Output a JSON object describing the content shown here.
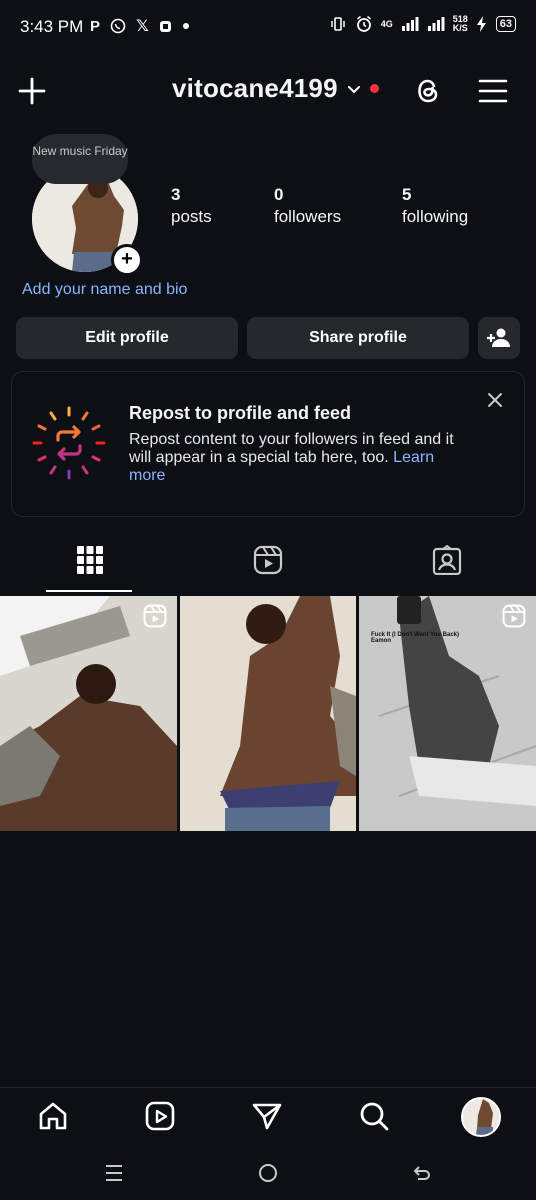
{
  "status_bar": {
    "time": "3:43 PM",
    "left_icons": [
      "p-icon",
      "whatsapp-icon",
      "x-icon",
      "app-icon",
      "dot-icon"
    ],
    "network": "4G",
    "speed_value": "518",
    "speed_unit": "K/S",
    "battery": "63"
  },
  "header": {
    "username": "vitocane4199"
  },
  "profile": {
    "note": "New music Friday",
    "stats": [
      {
        "value": "3",
        "label": "posts"
      },
      {
        "value": "0",
        "label": "followers"
      },
      {
        "value": "5",
        "label": "following"
      }
    ],
    "bio_link": "Add your name and bio",
    "edit_button": "Edit profile",
    "share_button": "Share profile"
  },
  "repost_card": {
    "title": "Repost to profile and feed",
    "body": "Repost content to your followers in feed and it will appear in a special tab here, too.",
    "learn_more": "Learn more"
  },
  "tabs": [
    "grid-icon",
    "reels-icon",
    "tagged-icon"
  ],
  "posts": [
    {
      "type": "reel",
      "caption_line1": "",
      "caption_line2": ""
    },
    {
      "type": "photo",
      "caption_line1": "",
      "caption_line2": ""
    },
    {
      "type": "reel",
      "caption_line1": "Fuck It (I Don't Want You Back)",
      "caption_line2": "Eamon"
    }
  ],
  "bottom_nav": [
    "home-icon",
    "reels-icon",
    "messages-icon",
    "search-icon",
    "profile-avatar"
  ],
  "system_nav": [
    "recents-icon",
    "home-circle-icon",
    "back-icon"
  ],
  "colors": {
    "background": "#0c1014",
    "button": "#25292e",
    "link": "#8ab4ff",
    "notification_dot": "#ff3040"
  }
}
